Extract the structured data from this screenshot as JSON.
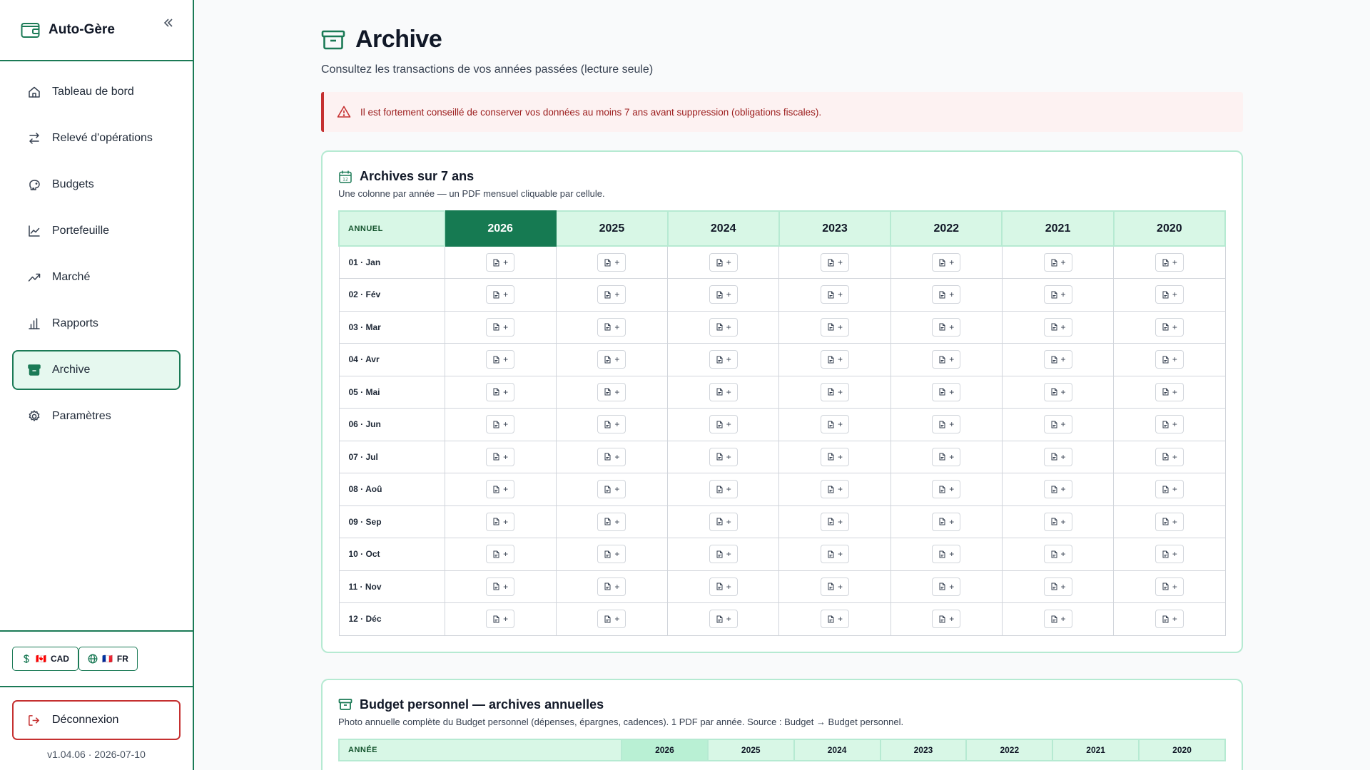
{
  "app": {
    "title": "Auto-Gère"
  },
  "sidebar": {
    "items": [
      {
        "label": "Tableau de bord",
        "icon": "home-icon"
      },
      {
        "label": "Relevé d'opérations",
        "icon": "swap-icon"
      },
      {
        "label": "Budgets",
        "icon": "piggy-bank-icon"
      },
      {
        "label": "Portefeuille",
        "icon": "line-chart-icon"
      },
      {
        "label": "Marché",
        "icon": "trending-up-icon"
      },
      {
        "label": "Rapports",
        "icon": "bar-chart-icon"
      },
      {
        "label": "Archive",
        "icon": "archive-icon",
        "active": true
      },
      {
        "label": "Paramètres",
        "icon": "gear-icon"
      }
    ],
    "currency_label": "CAD",
    "currency_flag": "🇨🇦",
    "language_label": "FR",
    "language_flag": "🇫🇷",
    "logout_label": "Déconnexion",
    "version": "v1.04.06 · 2026-07-10"
  },
  "page": {
    "title": "Archive",
    "subtitle": "Consultez les transactions de vos années passées (lecture seule)",
    "alert": "Il est fortement conseillé de conserver vos données au moins 7 ans avant suppression (obligations fiscales)."
  },
  "archives": {
    "title": "Archives sur 7 ans",
    "subtitle": "Une colonne par année — un PDF mensuel cliquable par cellule.",
    "header_label": "ANNUEL",
    "years": [
      "2026",
      "2025",
      "2024",
      "2023",
      "2022",
      "2021",
      "2020"
    ],
    "months": [
      "01 · Jan",
      "02 · Fév",
      "03 · Mar",
      "04 · Avr",
      "05 · Mai",
      "06 · Jun",
      "07 · Jul",
      "08 · Aoû",
      "09 · Sep",
      "10 · Oct",
      "11 · Nov",
      "12 · Déc"
    ],
    "cell_plus": "+"
  },
  "budget_archives": {
    "title": "Budget personnel — archives annuelles",
    "subtitle": "Photo annuelle complète du Budget personnel (dépenses, épargnes, cadences). 1 PDF par année. Source : Budget → Budget personnel.",
    "header_label": "ANNÉE",
    "years": [
      "2026",
      "2025",
      "2024",
      "2023",
      "2022",
      "2021",
      "2020"
    ]
  },
  "colors": {
    "accent": "#1b7a56",
    "danger": "#c53030",
    "accent_light": "#d8f7e6"
  }
}
